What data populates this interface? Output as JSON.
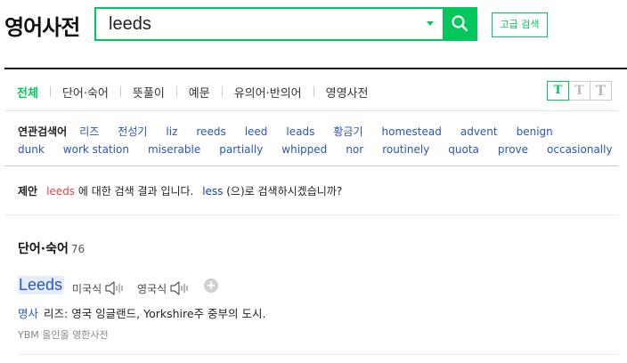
{
  "header": {
    "logo": "영어사전",
    "search_value": "leeds",
    "advanced_search": "고급 검색"
  },
  "tabs": {
    "items": [
      "전체",
      "단어·숙어",
      "뜻풀이",
      "예문",
      "유의어·반의어",
      "영영사전"
    ],
    "active_index": 0
  },
  "font_size_toggle": [
    "T",
    "T",
    "T"
  ],
  "related": {
    "label": "연관검색어",
    "row1": [
      "리즈",
      "전성기",
      "liz",
      "reeds",
      "leed",
      "leads",
      "황금기",
      "homestead",
      "advent",
      "benign"
    ],
    "row2": [
      "dunk",
      "work station",
      "miserable",
      "partially",
      "whipped",
      "nor",
      "routinely",
      "quota",
      "prove",
      "occasionally"
    ]
  },
  "suggestion": {
    "label": "제안",
    "wrong": "leeds",
    "middle": " 에 대한 검색 결과 입니다.",
    "right": "less",
    "tail": " (으)로 검색하시겠습니까?"
  },
  "section": {
    "title": "단어·숙어",
    "count": "76"
  },
  "entry": {
    "word": "Leeds",
    "us_label": "미국식",
    "uk_label": "영국식",
    "plus": "+",
    "pos": "명사",
    "meaning": "리즈: 영국 잉글랜드, Yorkshire주 중부의 도시.",
    "source": "YBM 올인올 영한사전"
  },
  "colors": {
    "accent": "#03c75a",
    "link": "#2b56b5",
    "warning": "#e8414a"
  }
}
